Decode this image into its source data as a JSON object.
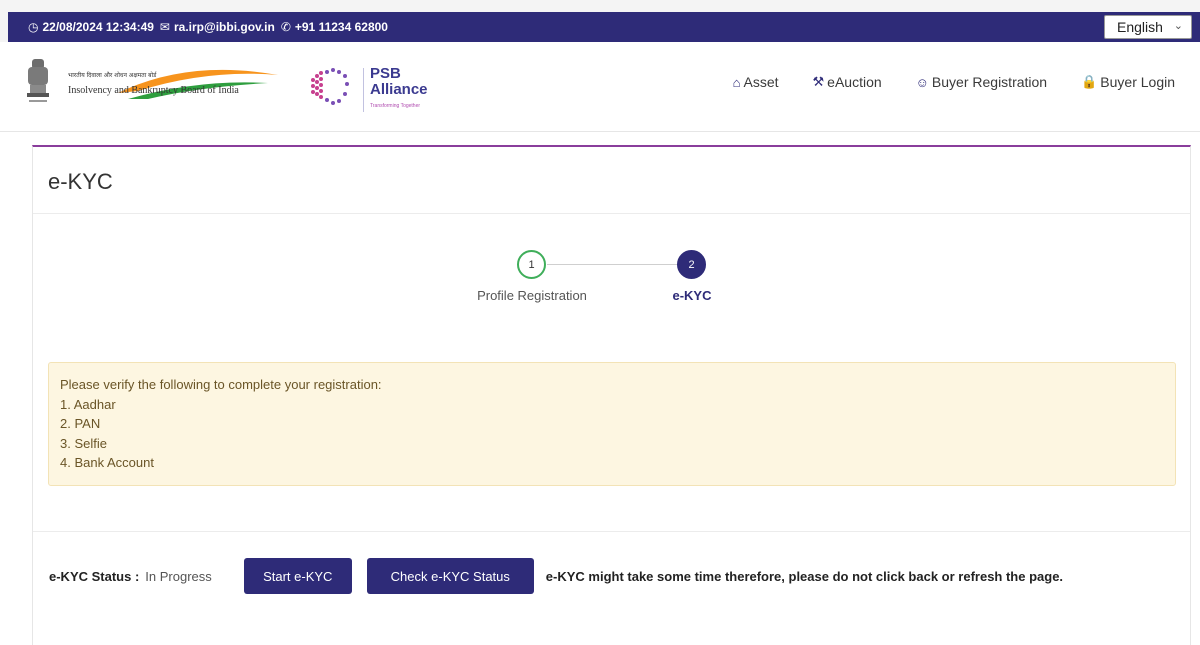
{
  "topbar": {
    "datetime": "22/08/2024 12:34:49",
    "email": "ra.irp@ibbi.gov.in",
    "phone": "+91 11234 62800",
    "language": "English"
  },
  "logos": {
    "ibbi_hindi": "भारतीय दिवाला और शोधन अक्षमता बोर्ड",
    "ibbi_english": "Insolvency and Bankruptcy Board of India",
    "psb_name": "PSB\nAlliance",
    "psb_tagline": "Transforming Together"
  },
  "nav": {
    "asset": "Asset",
    "eauction": "eAuction",
    "buyer_registration": "Buyer Registration",
    "buyer_login": "Buyer Login"
  },
  "page": {
    "title": "e-KYC"
  },
  "stepper": {
    "steps": [
      {
        "number": "1",
        "label": "Profile Registration",
        "state": "completed"
      },
      {
        "number": "2",
        "label": "e-KYC",
        "state": "active"
      }
    ]
  },
  "alert": {
    "intro": "Please verify the following to complete your registration:",
    "items": [
      "1. Aadhar",
      "2. PAN",
      "3. Selfie",
      "4. Bank Account"
    ]
  },
  "status": {
    "label": "e-KYC Status :",
    "value": "In Progress",
    "start_button": "Start e-KYC",
    "check_button": "Check e-KYC Status",
    "note": "e-KYC might take some time therefore, please do not click back or refresh the page."
  },
  "colors": {
    "primary": "#2e2b78",
    "accent_border": "#8a3d9c",
    "success": "#3fae5a",
    "alert_bg": "#fdf6e1"
  },
  "icons": {
    "datetime": "clock-icon",
    "email": "envelope-icon",
    "phone": "phone-icon",
    "asset": "home-icon",
    "eauction": "gavel-icon",
    "buyer_registration": "user-circle-icon",
    "buyer_login": "lock-icon"
  }
}
